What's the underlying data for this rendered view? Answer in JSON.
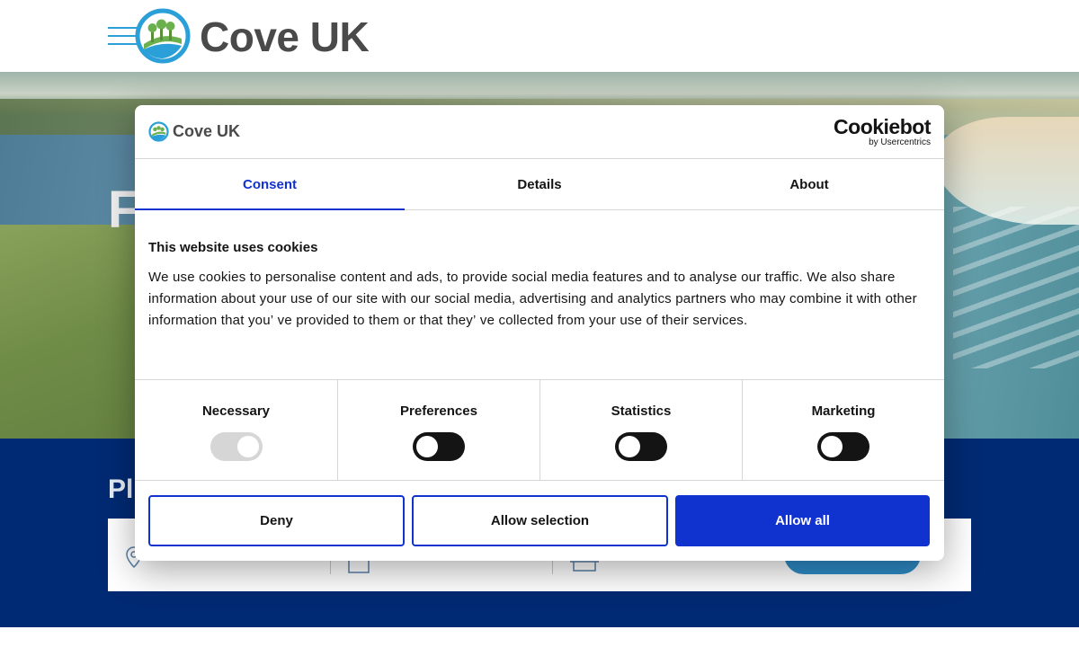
{
  "site": {
    "brand_name": "Cove UK",
    "hero_headline_partial": "F",
    "band_title_partial": "Pl"
  },
  "colors": {
    "brand_blue": "#002a73",
    "accent_blue": "#1032cf",
    "menu_blue": "#2a9fd8"
  },
  "cookie_dialog": {
    "brand_name": "Cove UK",
    "provider": "Cookiebot",
    "provider_sub": "by Usercentrics",
    "tabs": [
      {
        "label": "Consent",
        "active": true
      },
      {
        "label": "Details",
        "active": false
      },
      {
        "label": "About",
        "active": false
      }
    ],
    "title": "This website uses cookies",
    "body": "We use cookies to personalise content and ads, to provide social media features and to analyse our traffic. We also share information about your use of our site with our social media, advertising and analytics partners who may combine it with other information that you’ ve provided to them or that they’ ve collected from your use of their services.",
    "categories": [
      {
        "label": "Necessary",
        "enabled": true,
        "locked": true
      },
      {
        "label": "Preferences",
        "enabled": false,
        "locked": false
      },
      {
        "label": "Statistics",
        "enabled": false,
        "locked": false
      },
      {
        "label": "Marketing",
        "enabled": false,
        "locked": false
      }
    ],
    "buttons": {
      "deny": "Deny",
      "allow_selection": "Allow selection",
      "allow_all": "Allow all"
    }
  }
}
